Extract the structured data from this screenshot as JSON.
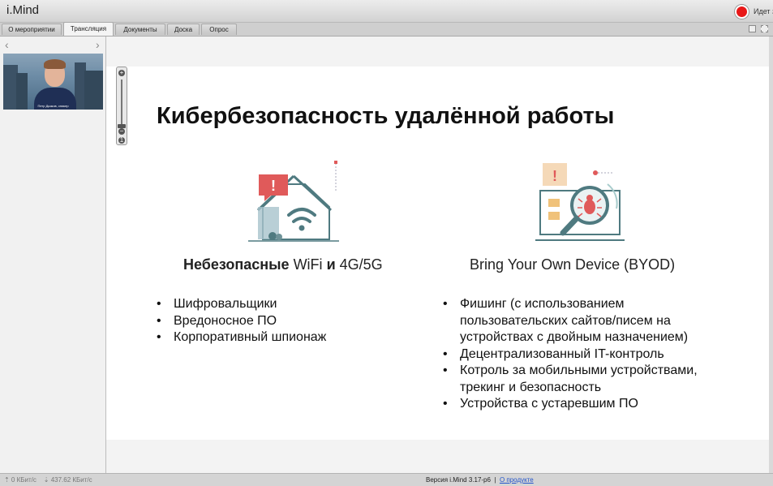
{
  "app": {
    "title": "i.Mind",
    "recording_label": "Идет з"
  },
  "tabs": [
    {
      "label": "О мероприятии",
      "active": false
    },
    {
      "label": "Трансляция",
      "active": true
    },
    {
      "label": "Документы",
      "active": false
    },
    {
      "label": "Доска",
      "active": false
    },
    {
      "label": "Опрос",
      "active": false
    }
  ],
  "left_panel": {
    "prev_arrow": "‹",
    "next_arrow": "›",
    "video_caption": "Петр Дьяков, спикер"
  },
  "zoom_control": {
    "plus": "+",
    "minus": "−",
    "info": "1"
  },
  "slide": {
    "title": "Кибербезопасность удалённой работы",
    "left_column": {
      "heading_bold_1": "Небезопасные",
      "heading_normal_1": "WiFi",
      "heading_bold_2": "и",
      "heading_normal_2": "4G/5G",
      "bullets": [
        "Шифровальщики",
        "Вредоносное ПО",
        "Корпоративный шпионаж"
      ]
    },
    "right_column": {
      "heading": "Bring Your Own Device (BYOD)",
      "bullets": [
        "Фишинг (с использованием",
        "пользовательских сайтов/писем на",
        "устройствах с двойным назначением)",
        "Децентрализованный IT-контроль",
        "Котроль за мобильными устройствами,",
        "трекинг и безопасность",
        "Устройства с устаревшим ПО"
      ]
    },
    "illustration_icons": [
      "home-wifi-alert-icon",
      "laptop-bug-magnifier-icon"
    ]
  },
  "status_bar": {
    "upload": "⇡ 0 КБит/с",
    "download": "⇣ 437.62 КБит/с",
    "version": "Версия i.Mind 3.17-p6",
    "separator": "|",
    "about_link": "О продукте"
  },
  "colors": {
    "accent_red": "#e05a5a",
    "teal": "#4f7a80",
    "illus_orange": "#f5d9b8",
    "record_red": "#e81818"
  }
}
